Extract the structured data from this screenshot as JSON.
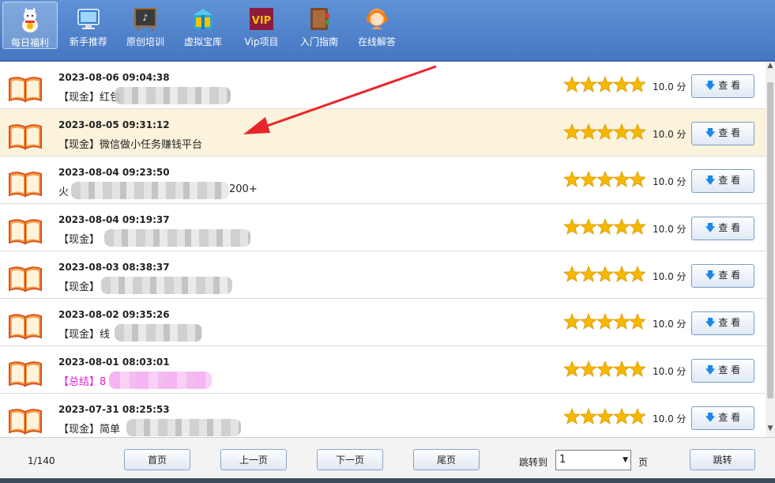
{
  "toolbar": {
    "items": [
      {
        "label": "每日福利",
        "icon": "lucky-cat-icon"
      },
      {
        "label": "新手推荐",
        "icon": "monitor-icon"
      },
      {
        "label": "原创培训",
        "icon": "blackboard-icon"
      },
      {
        "label": "虚拟宝库",
        "icon": "gift-box-icon"
      },
      {
        "label": "Vip项目",
        "icon": "vip-icon",
        "badge": "VIP"
      },
      {
        "label": "入门指南",
        "icon": "book-guide-icon"
      },
      {
        "label": "在线解答",
        "icon": "support-agent-icon"
      }
    ]
  },
  "list": {
    "rows": [
      {
        "date": "2023-08-06 09:04:38",
        "title": "【现金】红包",
        "score": "10.0 分",
        "rating": 5,
        "button": "查 看",
        "highlighted": false
      },
      {
        "date": "2023-08-05 09:31:12",
        "title": "【现金】微信做小任务赚钱平台",
        "score": "10.0 分",
        "rating": 5,
        "button": "查 看",
        "highlighted": true
      },
      {
        "date": "2023-08-04 09:23:50",
        "title": "火",
        "title_suffix": "200+",
        "score": "10.0 分",
        "rating": 5,
        "button": "查 看",
        "highlighted": false
      },
      {
        "date": "2023-08-04 09:19:37",
        "title": "【现金】",
        "score": "10.0 分",
        "rating": 5,
        "button": "查 看",
        "highlighted": false
      },
      {
        "date": "2023-08-03 08:38:37",
        "title": "【现金】",
        "score": "10.0 分",
        "rating": 5,
        "button": "查 看",
        "highlighted": false
      },
      {
        "date": "2023-08-02 09:35:26",
        "title": "【现金】线",
        "score": "10.0 分",
        "rating": 5,
        "button": "查 看",
        "highlighted": false
      },
      {
        "date": "2023-08-01 08:03:01",
        "title": "【总结】8",
        "score": "10.0 分",
        "rating": 5,
        "button": "查 看",
        "highlighted": false,
        "pink": true
      },
      {
        "date": "2023-07-31 08:25:53",
        "title": "【现金】简单",
        "score": "10.0 分",
        "rating": 5,
        "button": "查 看",
        "highlighted": false
      }
    ]
  },
  "pager": {
    "info": "1/140",
    "first": "首页",
    "prev": "上一页",
    "next": "下一页",
    "last": "尾页",
    "jump_label": "跳转到",
    "page_value": "1",
    "page_unit": "页",
    "jump_button": "跳转"
  },
  "colors": {
    "toolbar": "#4f83cc",
    "highlight_row": "#fbf3dc",
    "star": "#f5b800",
    "annotation_arrow": "#e8262a"
  }
}
